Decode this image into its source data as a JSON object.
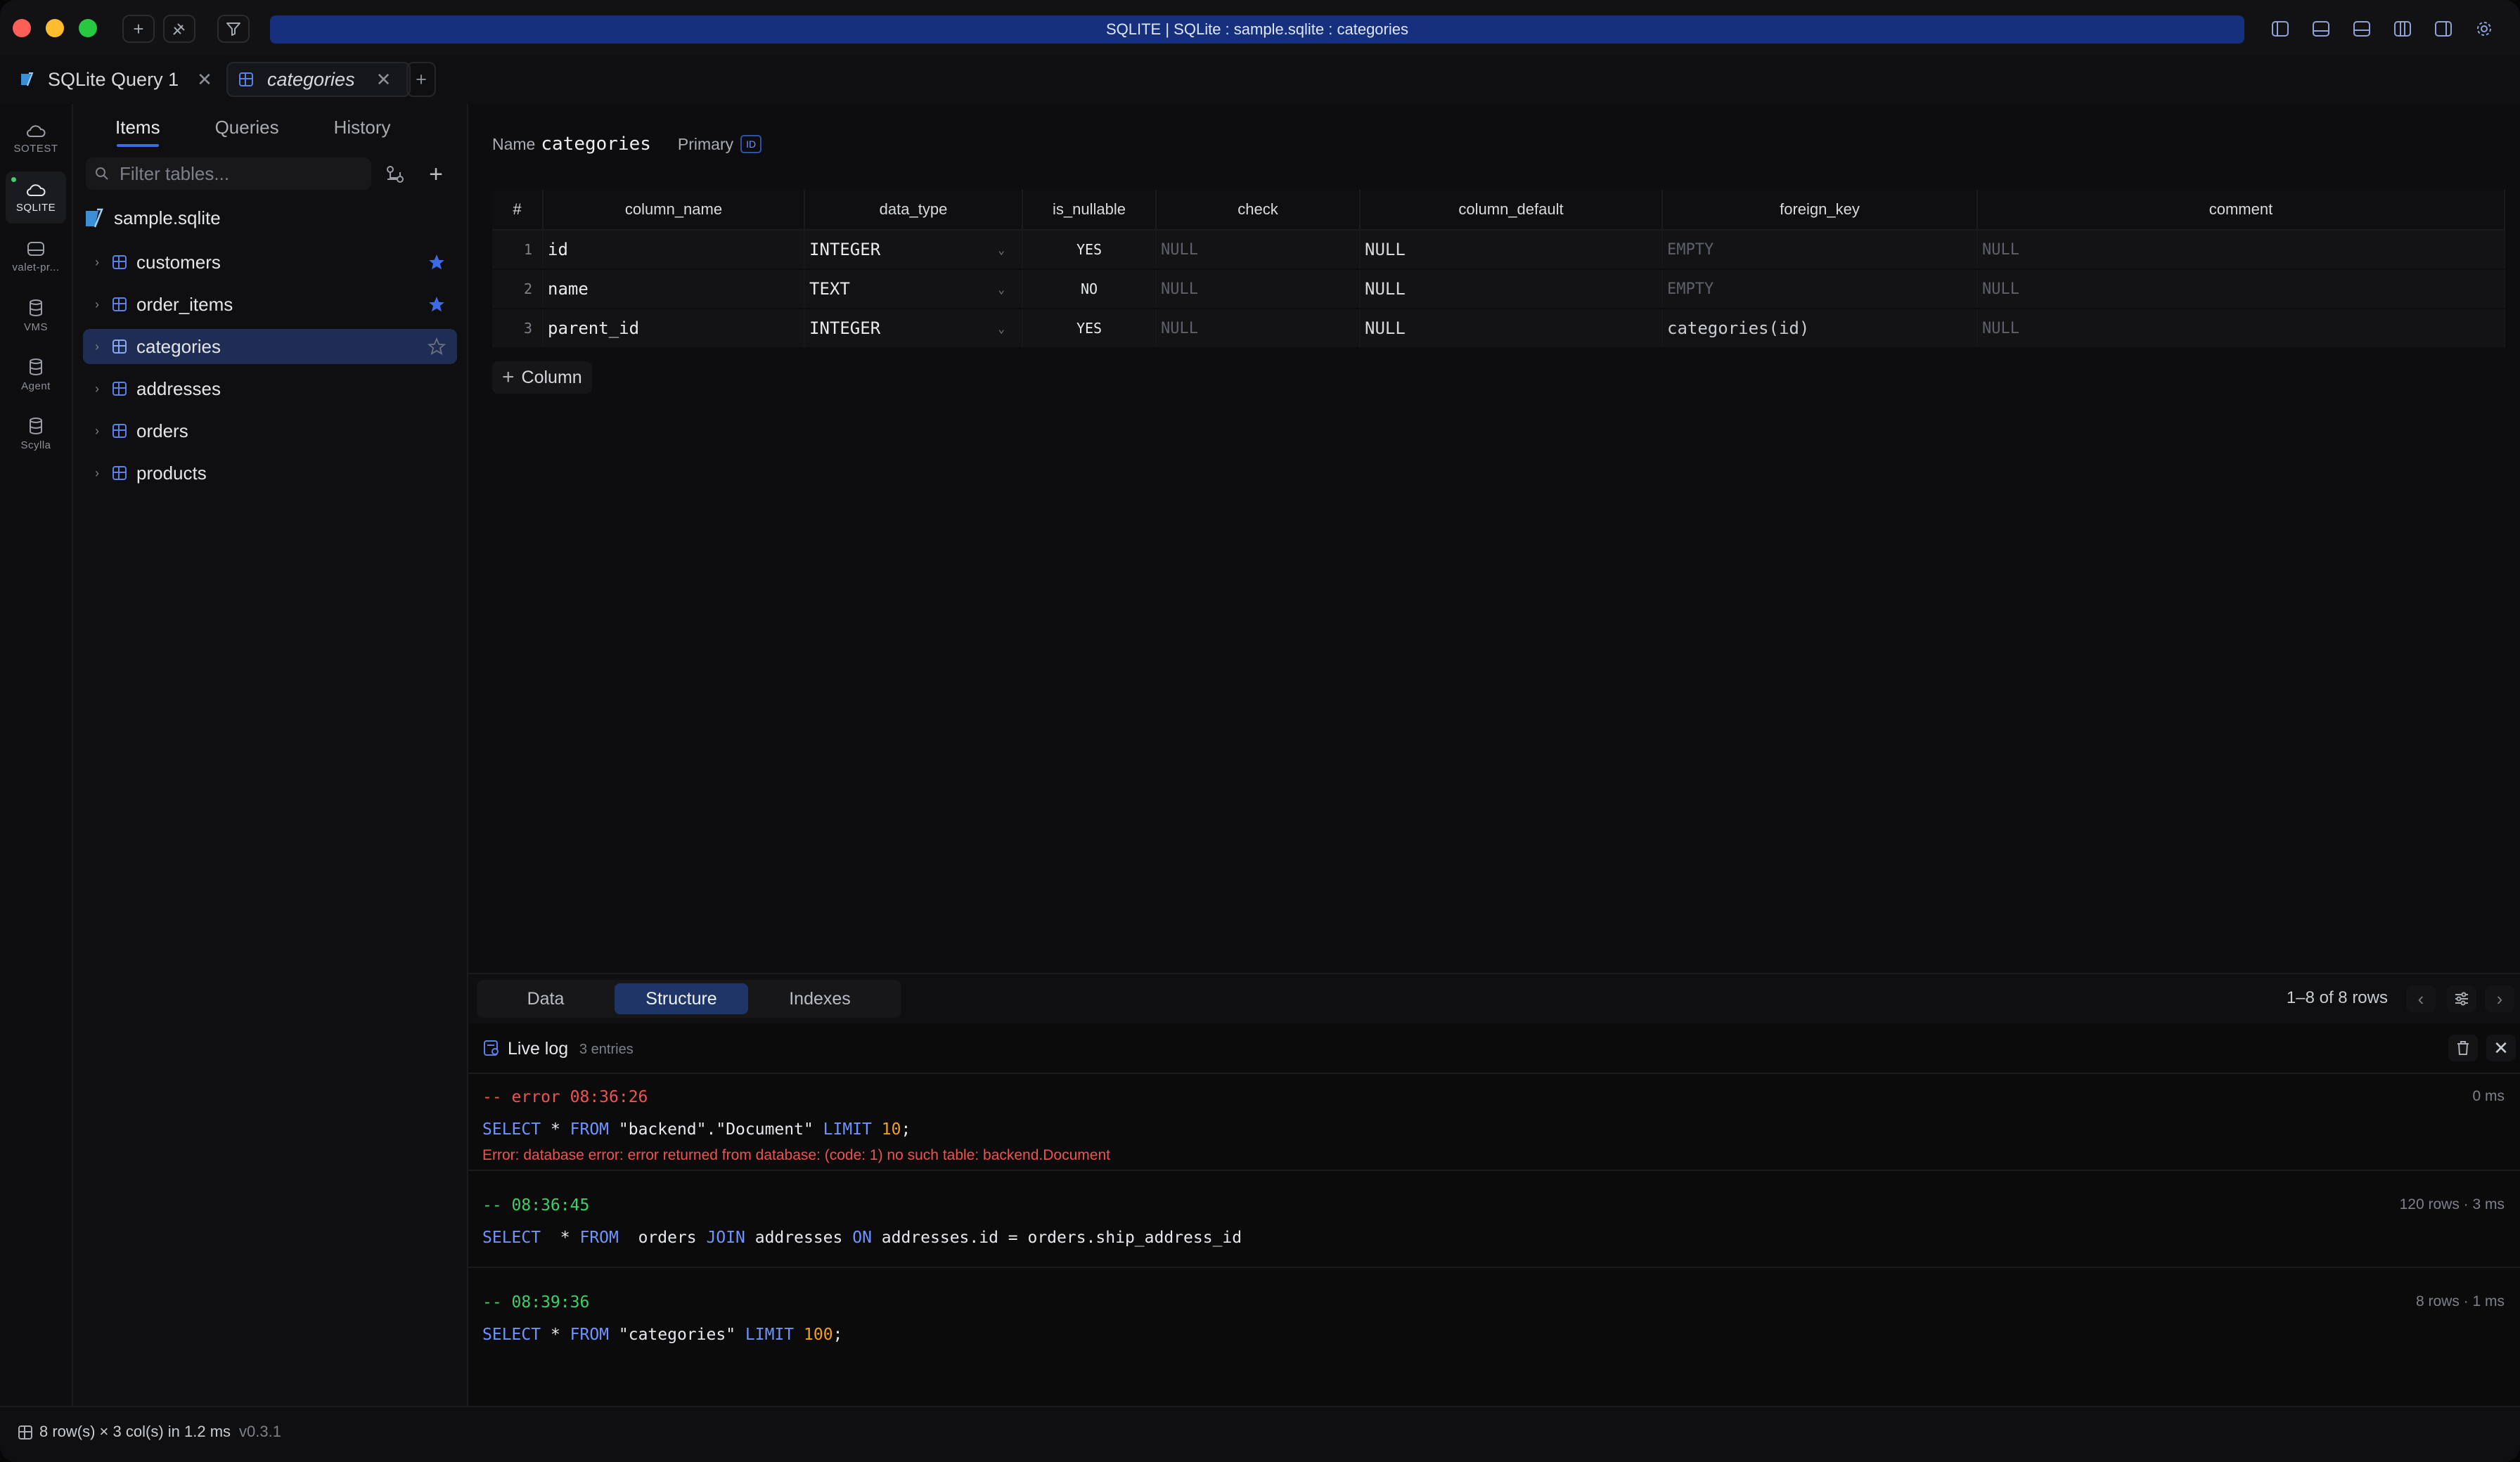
{
  "titlebar": {
    "title": "SQLITE | SQLite : sample.sqlite : categories"
  },
  "tabs": [
    {
      "label": "SQLite Query 1"
    },
    {
      "label": "categories"
    }
  ],
  "rail": [
    {
      "label": "SOTEST"
    },
    {
      "label": "SQLITE"
    },
    {
      "label": "valet-pr..."
    },
    {
      "label": "VMS"
    },
    {
      "label": "Agent"
    },
    {
      "label": "Scylla"
    }
  ],
  "sidebar": {
    "tabs": [
      "Items",
      "Queries",
      "History"
    ],
    "filter_placeholder": "Filter tables...",
    "database": "sample.sqlite",
    "tables": [
      {
        "name": "customers",
        "starred": true
      },
      {
        "name": "order_items",
        "starred": true
      },
      {
        "name": "categories",
        "starred": false
      },
      {
        "name": "addresses"
      },
      {
        "name": "orders"
      },
      {
        "name": "products"
      }
    ]
  },
  "structure": {
    "name_label": "Name",
    "name_value": "categories",
    "primary_label": "Primary",
    "primary_badge": "ID",
    "columns": [
      "#",
      "column_name",
      "data_type",
      "is_nullable",
      "check",
      "column_default",
      "foreign_key",
      "comment"
    ],
    "rows": [
      {
        "num": "1",
        "column_name": "id",
        "data_type": "INTEGER",
        "is_nullable": "YES",
        "check": "NULL",
        "column_default": "NULL",
        "foreign_key": "EMPTY",
        "comment": "NULL"
      },
      {
        "num": "2",
        "column_name": "name",
        "data_type": "TEXT",
        "is_nullable": "NO",
        "check": "NULL",
        "column_default": "NULL",
        "foreign_key": "EMPTY",
        "comment": "NULL"
      },
      {
        "num": "3",
        "column_name": "parent_id",
        "data_type": "INTEGER",
        "is_nullable": "YES",
        "check": "NULL",
        "column_default": "NULL",
        "foreign_key": "categories(id)",
        "comment": "NULL"
      }
    ],
    "add_column_label": "Column"
  },
  "view_tabs": {
    "data": "Data",
    "structure": "Structure",
    "indexes": "Indexes"
  },
  "pagination": {
    "rows_text": "1–8 of 8 rows"
  },
  "live_log": {
    "title": "Live log",
    "count": "3 entries",
    "entries": [
      {
        "timestamp": "-- error 08:36:26",
        "stat": "0 ms",
        "sql_kw1": "SELECT",
        "sql_part1": " * ",
        "sql_kw2": "FROM",
        "sql_part2": " \"backend\".\"Document\" ",
        "sql_kw3": "LIMIT",
        "sql_num": "10",
        "sql_end": ";",
        "error": "Error: database error: error returned from database: (code: 1) no such table: backend.Document"
      },
      {
        "timestamp": "-- 08:36:45",
        "stat": "120 rows · 3 ms",
        "sql_kw1": "SELECT",
        "sql_part1": "  * ",
        "sql_kw2": "FROM",
        "sql_part2": "  orders ",
        "sql_kw3": "JOIN",
        "sql_part3": " addresses ",
        "sql_kw4": "ON",
        "sql_part4": " addresses.id = orders.ship_address_id"
      },
      {
        "timestamp": "-- 08:39:36",
        "stat": "8 rows · 1 ms",
        "sql_kw1": "SELECT",
        "sql_part1": " * ",
        "sql_kw2": "FROM",
        "sql_part2": " \"categories\" ",
        "sql_kw3": "LIMIT",
        "sql_num": "100",
        "sql_end": ";"
      }
    ]
  },
  "statusbar": {
    "summary": "8 row(s) × 3 col(s) in 1.2 ms",
    "version": "v0.3.1"
  },
  "colors": {
    "accent": "#3d6be8",
    "titlebar_accent": "#16307e",
    "selected_row": "#1f2d55",
    "error": "#f05252",
    "timestamp_ok": "#3ecf6a",
    "keyword": "#6f93ff",
    "number": "#f0a020"
  }
}
